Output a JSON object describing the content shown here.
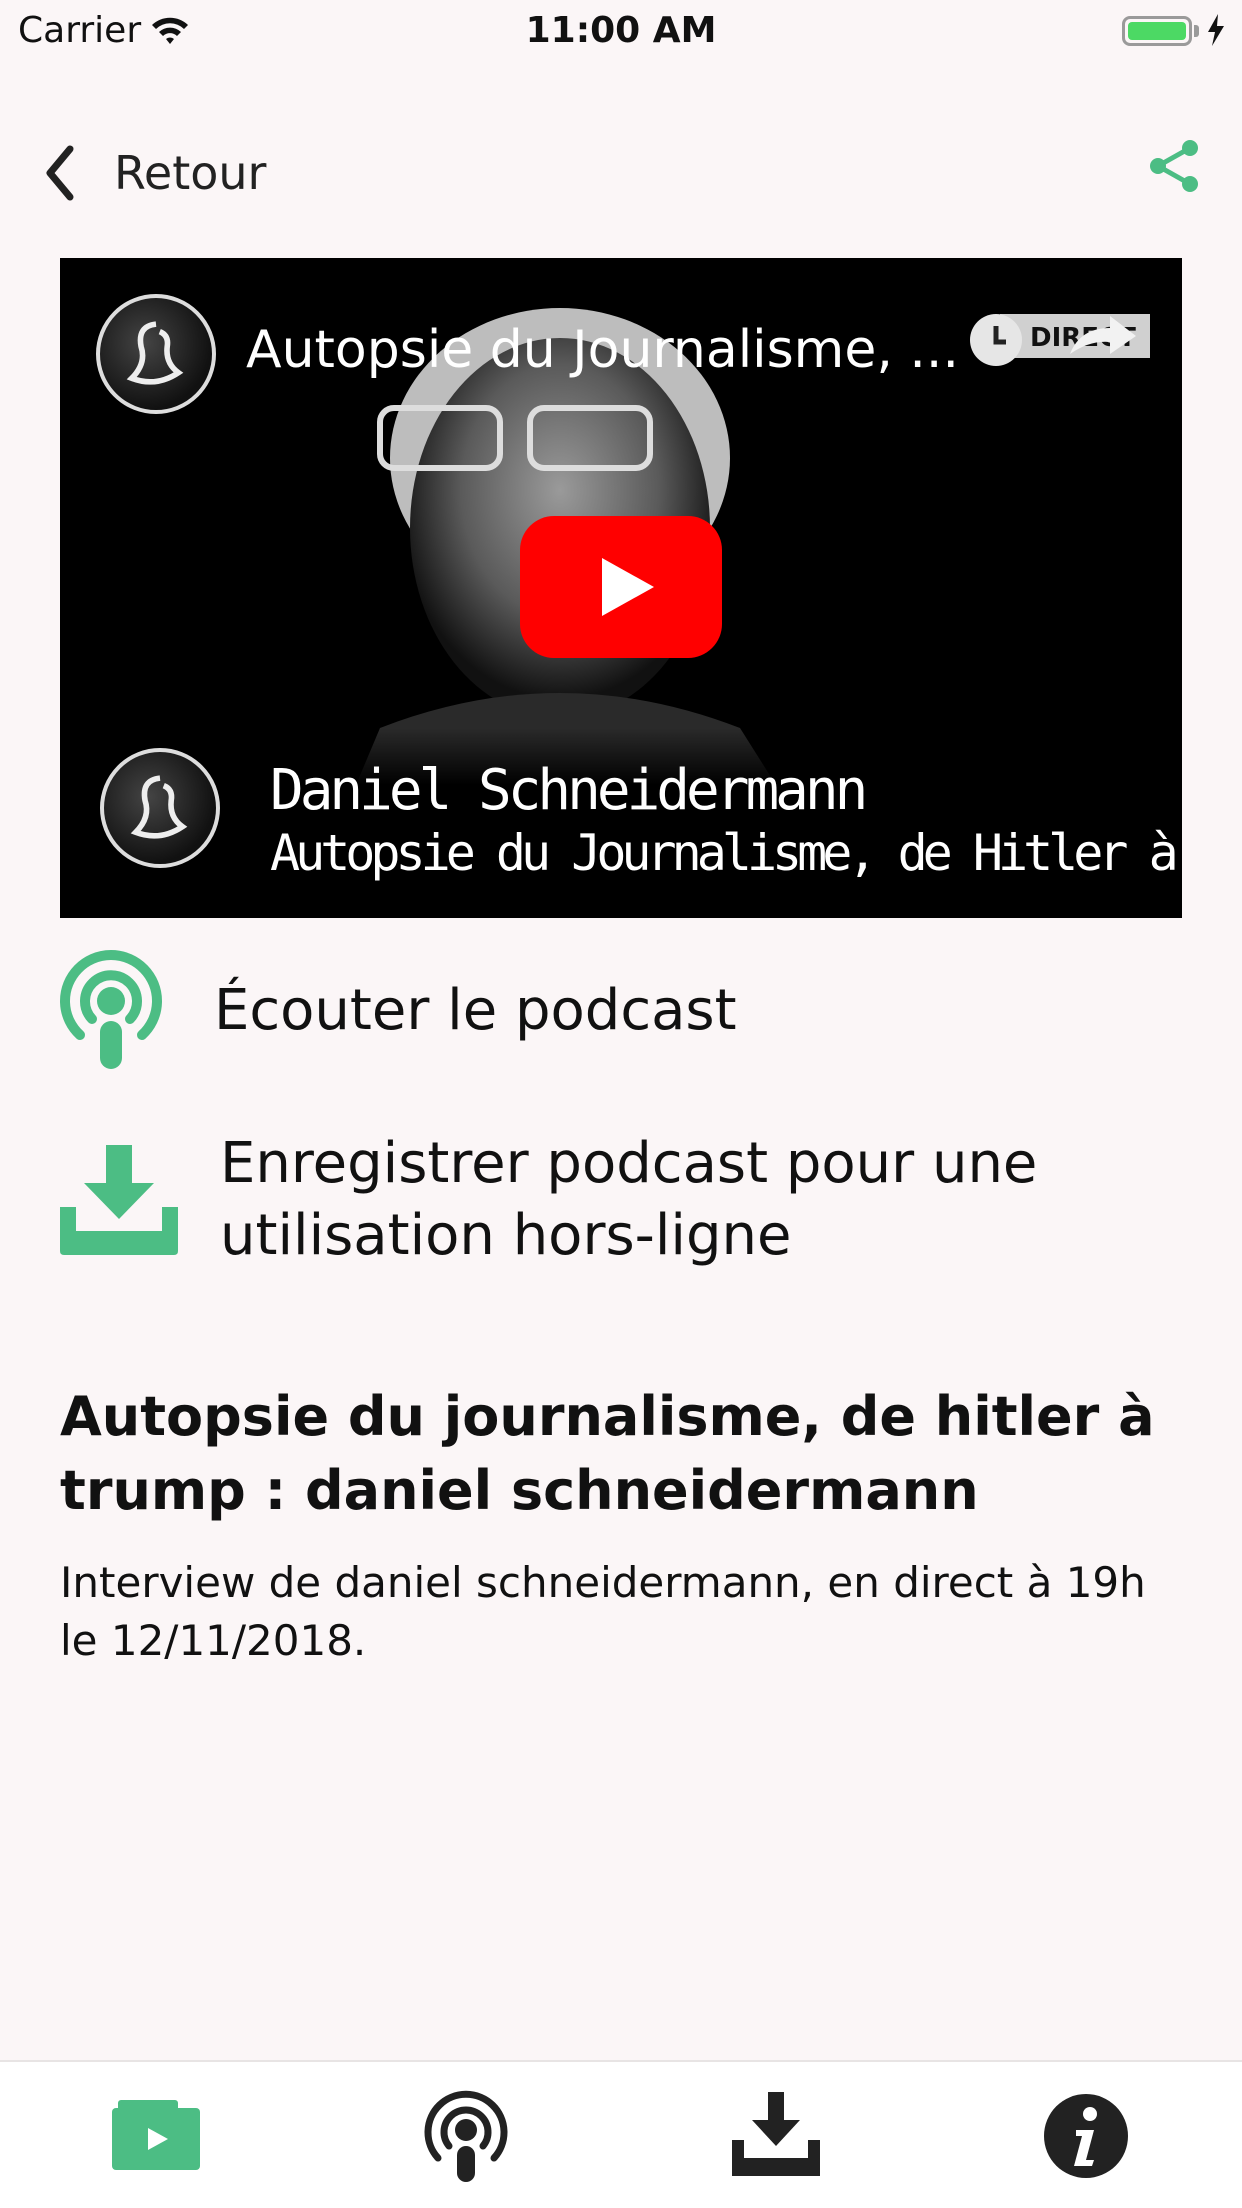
{
  "status_bar": {
    "carrier": "Carrier",
    "time": "11:00 AM"
  },
  "nav": {
    "back_label": "Retour",
    "back_icon": "chevron-left-icon",
    "share_icon": "share-icon"
  },
  "video": {
    "title": "Autopsie du Journalisme, ...",
    "watch_later_label": "DIRECT",
    "caption_name": "Daniel Schneidermann",
    "caption_subtitle": "Autopsie du Journalisme, de Hitler à Trump"
  },
  "actions": {
    "listen_label": "Écouter le podcast",
    "save_label": "Enregistrer podcast pour une utilisation hors-ligne"
  },
  "article": {
    "title": "Autopsie du journalisme, de hitler à trump : daniel schneidermann",
    "description": "Interview de daniel schneidermann, en direct à 19h le 12/11/2018."
  },
  "tabs": [
    {
      "icon": "video-folder-icon",
      "active": true
    },
    {
      "icon": "podcast-icon",
      "active": false
    },
    {
      "icon": "download-icon",
      "active": false
    },
    {
      "icon": "info-icon",
      "active": false
    }
  ],
  "colors": {
    "accent_green": "#4cbd84",
    "background": "#fbf6f7",
    "youtube_red": "#ff0000"
  }
}
